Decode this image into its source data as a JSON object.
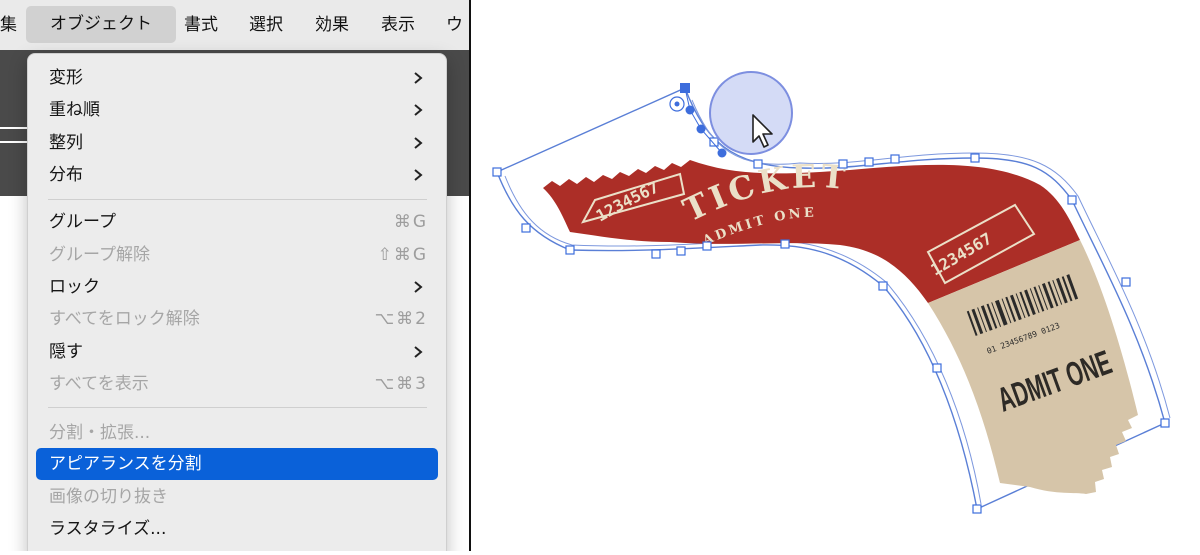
{
  "menubar": {
    "items": [
      "集",
      "オブジェクト",
      "書式",
      "選択",
      "効果",
      "表示",
      "ウ"
    ]
  },
  "object_menu": {
    "items": [
      {
        "label": "変形"
      },
      {
        "label": "重ね順"
      },
      {
        "label": "整列"
      },
      {
        "label": "分布"
      },
      {
        "label": "グループ",
        "shortcut": "⌘G"
      },
      {
        "label": "グループ解除",
        "shortcut": "⇧⌘G"
      },
      {
        "label": "ロック"
      },
      {
        "label": "すべてをロック解除",
        "shortcut": "⌥⌘2"
      },
      {
        "label": "隠す"
      },
      {
        "label": "すべてを表示",
        "shortcut": "⌥⌘3"
      },
      {
        "label": "分割・拡張..."
      },
      {
        "label": "アピアランスを分割"
      },
      {
        "label": "画像の切り抜き"
      },
      {
        "label": "ラスタライズ..."
      }
    ]
  },
  "ticket": {
    "stub_number_left": "1234567",
    "title": "TICKET",
    "subtitle": "ADMIT ONE",
    "stub_number_right": "1234567",
    "barcode_digits": "01 23456789 0123",
    "admit_text": "ADMIT ONE"
  },
  "colors": {
    "menu_highlight": "#0a61d9",
    "ticket_red": "#ac2e27",
    "ticket_cream": "#ebe0c8",
    "ticket_tan": "#d6c5a9",
    "selection_blue": "#3d6ddc"
  }
}
